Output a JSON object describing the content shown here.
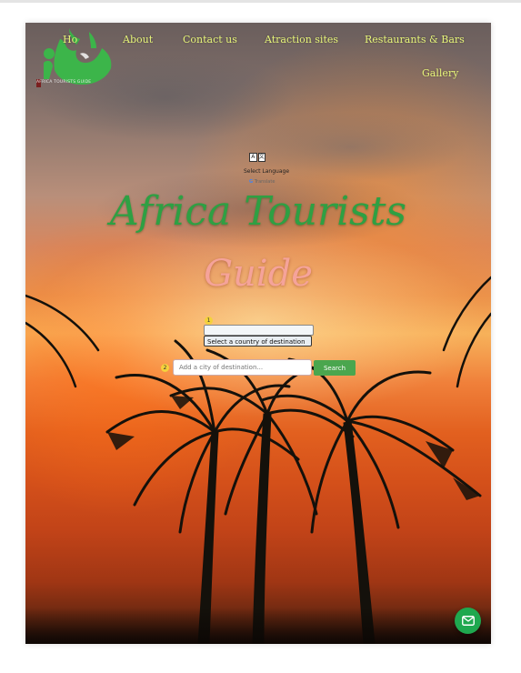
{
  "nav": {
    "items": [
      "Ho",
      "About",
      "Contact us",
      "Atraction sites",
      "Restaurants & Bars",
      "Gallery"
    ]
  },
  "logo": {
    "text": "AFRICA TOURISTS GUIDE"
  },
  "translate": {
    "label": "Select Language",
    "powered_by": "Translate",
    "google": "G"
  },
  "hero": {
    "title_line1": "Africa Tourists",
    "title_line2": "Guide"
  },
  "search": {
    "step1_badge": "1",
    "country_placeholder": "Select a country of destination",
    "step2_badge": "2",
    "city_placeholder": "Add a city of destination...",
    "button_label": "Search"
  },
  "colors": {
    "nav_text": "#e7f57a",
    "title_green": "#2ea043",
    "title_pink": "#f5a39a",
    "search_button": "#4aa64e",
    "mail_fab": "#1fa84f"
  },
  "icons": {
    "translate": "translate-icon",
    "mail": "mail-icon"
  }
}
